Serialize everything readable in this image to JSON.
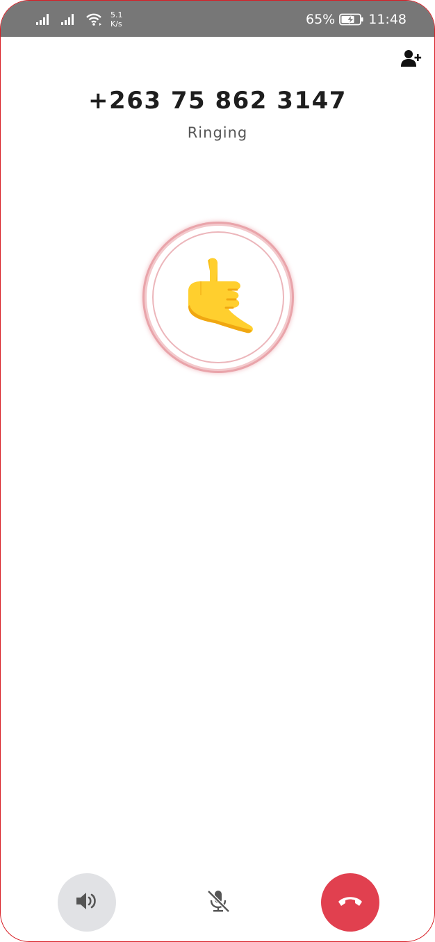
{
  "status_bar": {
    "network_speed_value": "5.1",
    "network_speed_unit": "K/s",
    "battery_percent": "65%",
    "time": "11:48",
    "icons": [
      "signal-icon",
      "signal-icon",
      "wifi-icon",
      "battery-charging-icon"
    ]
  },
  "call": {
    "number": "+263 75 862 3147",
    "status": "Ringing",
    "avatar_emoji": "call-me-hand-icon"
  },
  "actions": {
    "add_contact": "add-contact-icon",
    "speaker": "speaker-icon",
    "mute": "mic-off-icon",
    "hang_up": "hang-up-icon"
  },
  "colors": {
    "status_bar_bg": "#777777",
    "hangup_red": "#e1404f",
    "speaker_bg": "#e1e2e5",
    "avatar_ring": "#e9a4aa",
    "frame_border": "#d81f26"
  }
}
